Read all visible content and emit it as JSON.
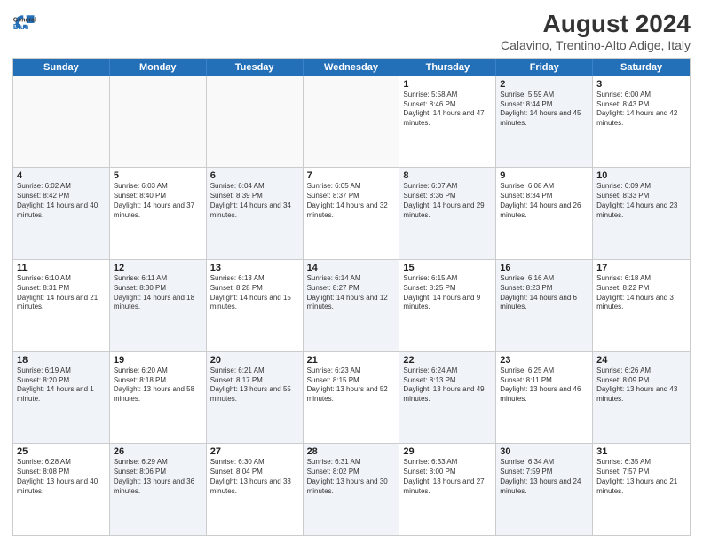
{
  "header": {
    "logo": {
      "line1": "General",
      "line2": "Blue"
    },
    "title": "August 2024",
    "location": "Calavino, Trentino-Alto Adige, Italy"
  },
  "calendar": {
    "days_of_week": [
      "Sunday",
      "Monday",
      "Tuesday",
      "Wednesday",
      "Thursday",
      "Friday",
      "Saturday"
    ],
    "weeks": [
      [
        {
          "day": "",
          "info": ""
        },
        {
          "day": "",
          "info": ""
        },
        {
          "day": "",
          "info": ""
        },
        {
          "day": "",
          "info": ""
        },
        {
          "day": "1",
          "info": "Sunrise: 5:58 AM\nSunset: 8:46 PM\nDaylight: 14 hours and 47 minutes."
        },
        {
          "day": "2",
          "info": "Sunrise: 5:59 AM\nSunset: 8:44 PM\nDaylight: 14 hours and 45 minutes."
        },
        {
          "day": "3",
          "info": "Sunrise: 6:00 AM\nSunset: 8:43 PM\nDaylight: 14 hours and 42 minutes."
        }
      ],
      [
        {
          "day": "4",
          "info": "Sunrise: 6:02 AM\nSunset: 8:42 PM\nDaylight: 14 hours and 40 minutes."
        },
        {
          "day": "5",
          "info": "Sunrise: 6:03 AM\nSunset: 8:40 PM\nDaylight: 14 hours and 37 minutes."
        },
        {
          "day": "6",
          "info": "Sunrise: 6:04 AM\nSunset: 8:39 PM\nDaylight: 14 hours and 34 minutes."
        },
        {
          "day": "7",
          "info": "Sunrise: 6:05 AM\nSunset: 8:37 PM\nDaylight: 14 hours and 32 minutes."
        },
        {
          "day": "8",
          "info": "Sunrise: 6:07 AM\nSunset: 8:36 PM\nDaylight: 14 hours and 29 minutes."
        },
        {
          "day": "9",
          "info": "Sunrise: 6:08 AM\nSunset: 8:34 PM\nDaylight: 14 hours and 26 minutes."
        },
        {
          "day": "10",
          "info": "Sunrise: 6:09 AM\nSunset: 8:33 PM\nDaylight: 14 hours and 23 minutes."
        }
      ],
      [
        {
          "day": "11",
          "info": "Sunrise: 6:10 AM\nSunset: 8:31 PM\nDaylight: 14 hours and 21 minutes."
        },
        {
          "day": "12",
          "info": "Sunrise: 6:11 AM\nSunset: 8:30 PM\nDaylight: 14 hours and 18 minutes."
        },
        {
          "day": "13",
          "info": "Sunrise: 6:13 AM\nSunset: 8:28 PM\nDaylight: 14 hours and 15 minutes."
        },
        {
          "day": "14",
          "info": "Sunrise: 6:14 AM\nSunset: 8:27 PM\nDaylight: 14 hours and 12 minutes."
        },
        {
          "day": "15",
          "info": "Sunrise: 6:15 AM\nSunset: 8:25 PM\nDaylight: 14 hours and 9 minutes."
        },
        {
          "day": "16",
          "info": "Sunrise: 6:16 AM\nSunset: 8:23 PM\nDaylight: 14 hours and 6 minutes."
        },
        {
          "day": "17",
          "info": "Sunrise: 6:18 AM\nSunset: 8:22 PM\nDaylight: 14 hours and 3 minutes."
        }
      ],
      [
        {
          "day": "18",
          "info": "Sunrise: 6:19 AM\nSunset: 8:20 PM\nDaylight: 14 hours and 1 minute."
        },
        {
          "day": "19",
          "info": "Sunrise: 6:20 AM\nSunset: 8:18 PM\nDaylight: 13 hours and 58 minutes."
        },
        {
          "day": "20",
          "info": "Sunrise: 6:21 AM\nSunset: 8:17 PM\nDaylight: 13 hours and 55 minutes."
        },
        {
          "day": "21",
          "info": "Sunrise: 6:23 AM\nSunset: 8:15 PM\nDaylight: 13 hours and 52 minutes."
        },
        {
          "day": "22",
          "info": "Sunrise: 6:24 AM\nSunset: 8:13 PM\nDaylight: 13 hours and 49 minutes."
        },
        {
          "day": "23",
          "info": "Sunrise: 6:25 AM\nSunset: 8:11 PM\nDaylight: 13 hours and 46 minutes."
        },
        {
          "day": "24",
          "info": "Sunrise: 6:26 AM\nSunset: 8:09 PM\nDaylight: 13 hours and 43 minutes."
        }
      ],
      [
        {
          "day": "25",
          "info": "Sunrise: 6:28 AM\nSunset: 8:08 PM\nDaylight: 13 hours and 40 minutes."
        },
        {
          "day": "26",
          "info": "Sunrise: 6:29 AM\nSunset: 8:06 PM\nDaylight: 13 hours and 36 minutes."
        },
        {
          "day": "27",
          "info": "Sunrise: 6:30 AM\nSunset: 8:04 PM\nDaylight: 13 hours and 33 minutes."
        },
        {
          "day": "28",
          "info": "Sunrise: 6:31 AM\nSunset: 8:02 PM\nDaylight: 13 hours and 30 minutes."
        },
        {
          "day": "29",
          "info": "Sunrise: 6:33 AM\nSunset: 8:00 PM\nDaylight: 13 hours and 27 minutes."
        },
        {
          "day": "30",
          "info": "Sunrise: 6:34 AM\nSunset: 7:59 PM\nDaylight: 13 hours and 24 minutes."
        },
        {
          "day": "31",
          "info": "Sunrise: 6:35 AM\nSunset: 7:57 PM\nDaylight: 13 hours and 21 minutes."
        }
      ]
    ]
  }
}
